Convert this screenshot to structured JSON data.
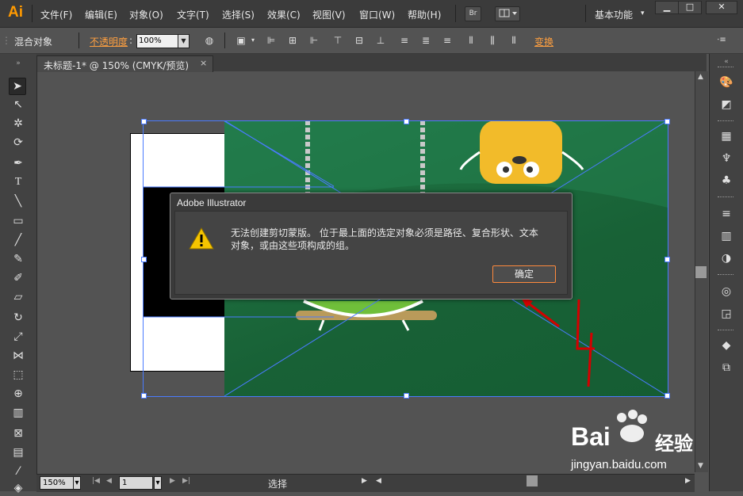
{
  "app": {
    "logo": "Ai",
    "workspace": "基本功能"
  },
  "menu": [
    "文件(F)",
    "编辑(E)",
    "对象(O)",
    "文字(T)",
    "选择(S)",
    "效果(C)",
    "视图(V)",
    "窗口(W)",
    "帮助(H)"
  ],
  "menubar": {
    "bridge_label": "Br"
  },
  "control": {
    "selection_label": "混合对象",
    "opacity_label": "不透明度",
    "opacity_value": "100%",
    "transform_label": "变换"
  },
  "tab": {
    "title": "未标题-1* @ 150% (CMYK/预览)",
    "close": "×"
  },
  "dialog": {
    "title": "Adobe Illustrator",
    "message": "无法创建剪切蒙版。 位于最上面的选定对象必须是路径、复合形状、文本对象，或由这些项构成的组。",
    "ok_label": "确定"
  },
  "status": {
    "zoom": "150%",
    "page": "1",
    "tool_label": "选择"
  },
  "annotation": {
    "text": "4",
    "color": "#d40000"
  },
  "watermark": {
    "logo": "Bai",
    "title": "经验",
    "url": "jingyan.baidu.com"
  },
  "colors": {
    "accent": "#ff9a00",
    "selection": "#4a7bff",
    "ok_border": "#ff8a3c"
  }
}
